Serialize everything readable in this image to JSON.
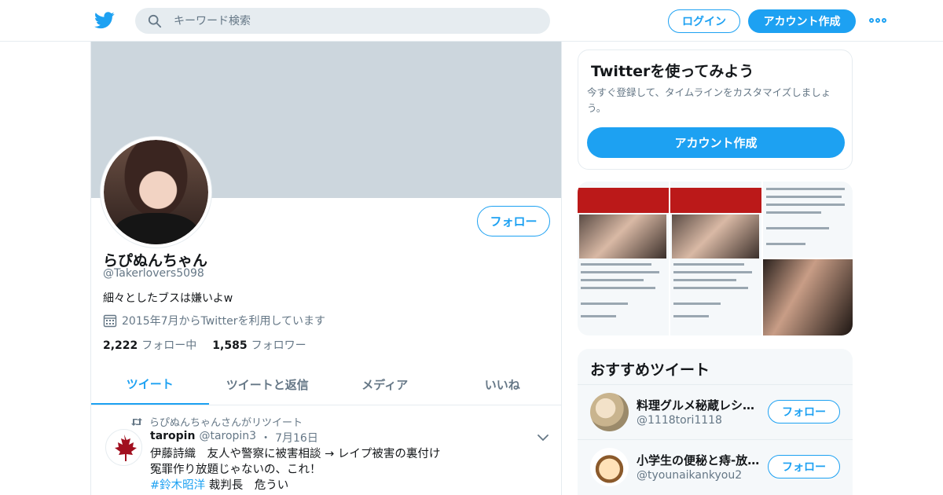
{
  "nav": {
    "search_placeholder": "キーワード検索",
    "login_label": "ログイン",
    "signup_label": "アカウント作成"
  },
  "profile": {
    "follow_label": "フォロー",
    "name": "らぴぬんちゃん",
    "handle": "@Takerlovers5098",
    "bio": "細々としたブスは嫌いよw",
    "joined": "2015年7月からTwitterを利用しています",
    "following_count": "2,222",
    "following_label": "フォロー中",
    "followers_count": "1,585",
    "followers_label": "フォロワー"
  },
  "tabs": [
    {
      "label": "ツイート",
      "active": true
    },
    {
      "label": "ツイートと返信",
      "active": false
    },
    {
      "label": "メディア",
      "active": false
    },
    {
      "label": "いいね",
      "active": false
    }
  ],
  "tweet": {
    "retweet_context": "らぴぬんちゃんさんがリツイート",
    "author_name": "taropin",
    "author_handle": "@taropin3",
    "separator": "・",
    "date": "7月16日",
    "line1": "伊藤詩織　友人や警察に被害相談 → レイプ被害の裏付け",
    "line2": "冤罪作り放題じゃないの、これ！",
    "hashtag": "#鈴木昭洋",
    "line3_rest": " 裁判長　危うい"
  },
  "signup_card": {
    "title": "Twitterを使ってみよう",
    "description": "今すぐ登録して、タイムラインをカスタマイズしましょう。",
    "button_label": "アカウント作成"
  },
  "recommended": {
    "title": "おすすめツイート",
    "items": [
      {
        "name": "料理グルメ秘蔵レシ…",
        "handle": "@1118tori1118",
        "follow_label": "フォロー"
      },
      {
        "name": "小学生の便秘と痔-放…",
        "handle": "@tyounaikankyou2",
        "follow_label": "フォロー"
      }
    ]
  },
  "colors": {
    "accent": "#1da1f2",
    "banner": "#ccd6dd",
    "muted_text": "#657786"
  }
}
